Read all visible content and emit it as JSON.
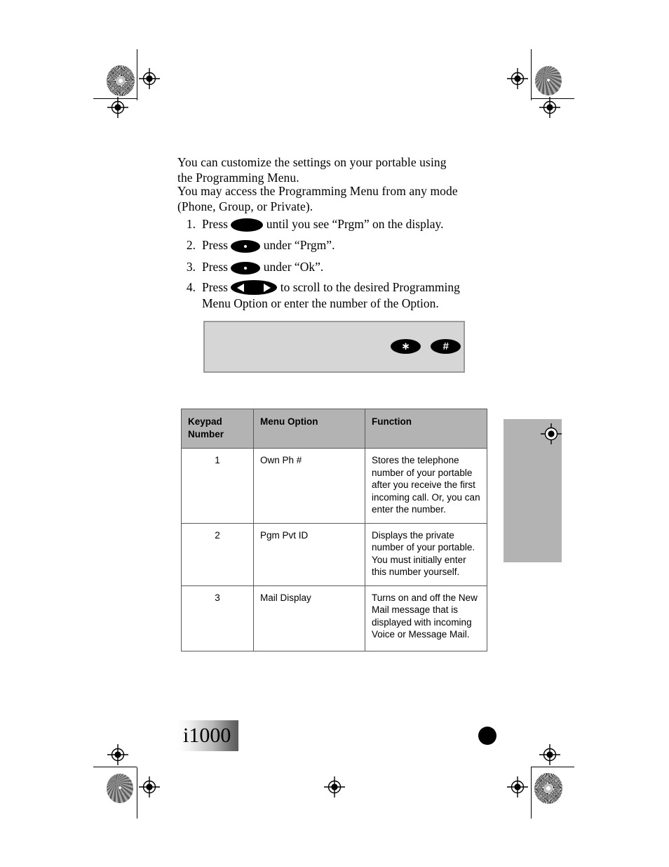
{
  "document": {
    "title": "i1000 Programming Menu",
    "model_badge": "i1000"
  },
  "body": {
    "paragraph_1": "You can customize the settings on your portable using the Programming Menu.",
    "paragraph_2": "You may access the Programming Menu from any mode (Phone, Group, or Private).",
    "steps": [
      {
        "number": "1.",
        "text_before": "Press",
        "key": "menu-key",
        "text_after": "until you see “Prgm” on the display."
      },
      {
        "number": "2.",
        "text_before": "Press",
        "key": "soft-key",
        "text_after": "under “Prgm”."
      },
      {
        "number": "3.",
        "text_before": "Press",
        "key": "soft-key",
        "text_after": "under “Ok”."
      },
      {
        "number": "4.",
        "text_before": "Press",
        "key": "scroll-key",
        "text_after": "to scroll to the desired Programming Menu Option or enter the number of the Option."
      }
    ]
  },
  "callout": {
    "star_key": "∗",
    "pound_key": "#"
  },
  "table": {
    "headers": [
      "Keypad Number",
      "Menu Option",
      "Function"
    ],
    "rows": [
      {
        "keypad_number": "1",
        "menu_option": "Own Ph #",
        "function": "Stores the telephone number of your portable after you receive the first incoming call. Or, you can enter the number."
      },
      {
        "keypad_number": "2",
        "menu_option": "Pgm Pvt ID",
        "function": "Displays the private number of your portable. You must initially enter this number yourself."
      },
      {
        "keypad_number": "3",
        "menu_option": "Mail Display",
        "function": "Turns on and off the New Mail message that is displayed with incoming Voice or Message Mail."
      }
    ]
  },
  "colors": {
    "callout_fill": "#d6d6d6",
    "callout_border": "#9a9a9a",
    "table_header_fill": "#b3b3b3",
    "table_border": "#595959",
    "thumb_tab_fill": "#b3b3b3",
    "key_fill": "#000000"
  }
}
